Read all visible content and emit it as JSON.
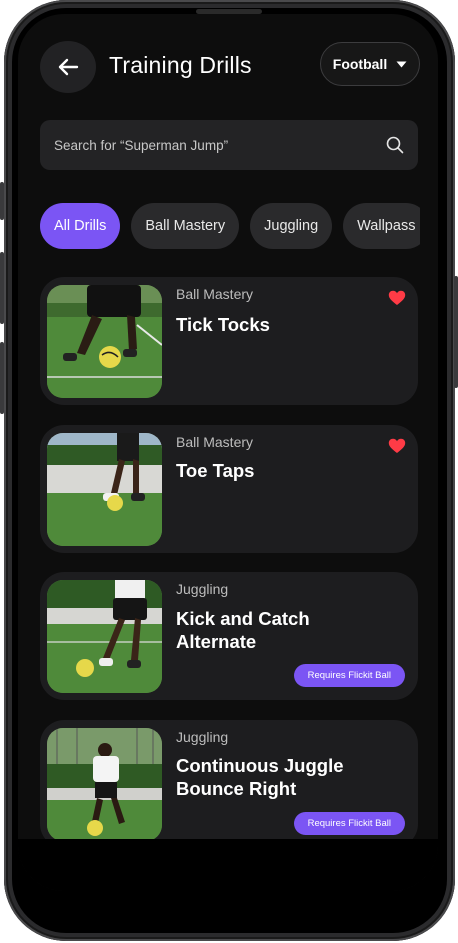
{
  "header": {
    "title": "Training Drills",
    "sport_selector": "Football"
  },
  "search": {
    "placeholder": "Search for  “Superman Jump”"
  },
  "chips": [
    {
      "label": "All Drills",
      "active": true
    },
    {
      "label": "Ball Mastery",
      "active": false
    },
    {
      "label": "Juggling",
      "active": false
    },
    {
      "label": "Wallpass",
      "active": false
    }
  ],
  "drills": [
    {
      "category": "Ball Mastery",
      "name": "Tick Tocks",
      "favorite": true,
      "badge": ""
    },
    {
      "category": "Ball Mastery",
      "name": "Toe Taps",
      "favorite": true,
      "badge": ""
    },
    {
      "category": "Juggling",
      "name": "Kick and Catch Alternate",
      "favorite": false,
      "badge": "Requires Flickit Ball"
    },
    {
      "category": "Juggling",
      "name": "Continuous Juggle Bounce Right",
      "favorite": false,
      "badge": "Requires Flickit Ball"
    }
  ],
  "colors": {
    "accent": "#7b55f4",
    "heart": "#ff3b46",
    "background": "#0d0d0d",
    "card": "#1d1d1f"
  },
  "icons": [
    "arrow-left-icon",
    "caret-down-icon",
    "search-icon",
    "heart-icon"
  ]
}
